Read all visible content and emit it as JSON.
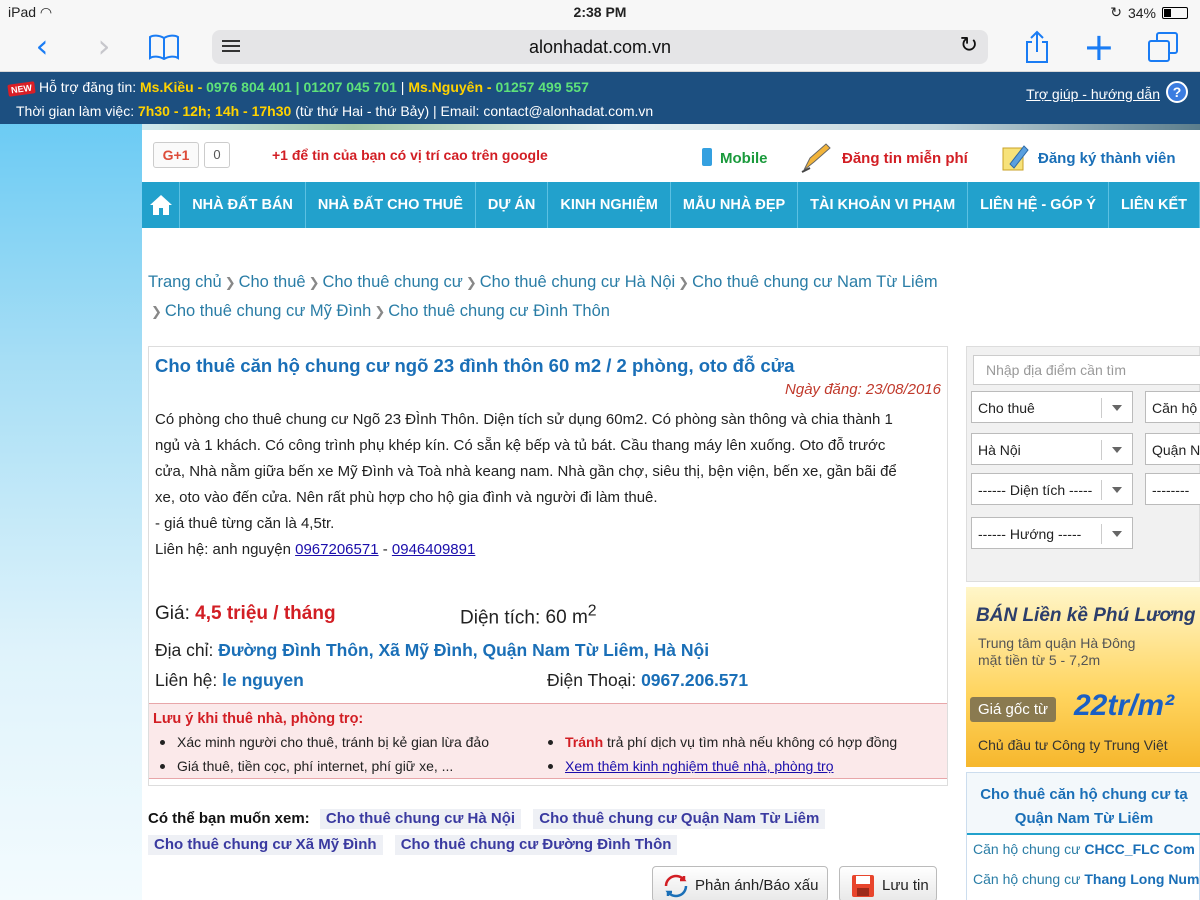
{
  "status": {
    "device": "iPad",
    "time": "2:38 PM",
    "battery": "34%",
    "battery_level": 0.34
  },
  "browser": {
    "url": "alonhadat.com.vn"
  },
  "support": {
    "row1_prefix": "Hỗ trợ đăng tin:",
    "name1": "Ms.Kiều -",
    "phones1": "0976 804 401 | 01207 045 701",
    "name2": "Ms.Nguyên -",
    "phone2": "01257 499 557",
    "row2_prefix": "Thời gian làm việc:",
    "hours": "7h30 - 12h; 14h - 17h30",
    "row2_suffix": "(từ thứ Hai - thứ Bảy) | Email: contact@alonhadat.com.vn",
    "help": "Trợ giúp - hướng dẫn",
    "hot_badge": "NEW"
  },
  "topbar": {
    "gplus": "G+1",
    "gcount": "0",
    "gtext": "+1 để tin của bạn có vị trí cao trên google",
    "mobile": "Mobile",
    "post_free": "Đăng tin miễn phí",
    "register": "Đăng ký thành viên"
  },
  "nav": [
    "NHÀ ĐẤT BÁN",
    "NHÀ ĐẤT CHO THUÊ",
    "DỰ ÁN",
    "KINH NGHIỆM",
    "MẪU NHÀ ĐẸP",
    "TÀI KHOẢN VI PHẠM",
    "LIÊN HỆ - GÓP Ý",
    "LIÊN KẾT"
  ],
  "breadcrumb": [
    "Trang chủ",
    "Cho thuê",
    "Cho thuê chung cư",
    "Cho thuê chung cư Hà Nội",
    "Cho thuê chung cư Nam Từ Liêm",
    "Cho thuê chung cư Mỹ Đình",
    "Cho thuê chung cư Đình Thôn"
  ],
  "listing": {
    "title": "Cho thuê căn hộ chung cư ngõ 23 đình thôn 60 m2 / 2 phòng, oto đỗ cửa",
    "date": "Ngày đăng: 23/08/2016",
    "desc1": "Có phòng cho thuê chung cư Ngõ 23 ĐÌnh Thôn. Diện tích sử dụng 60m2. Có phòng sàn thông và chia thành 1",
    "desc2": "ngủ và 1 khách. Có công trình phụ khép kín. Có sẵn kệ bếp và tủ bát. Cầu thang máy lên xuống. Oto đỗ trước",
    "desc3": "cửa, Nhà nằm giữa bến xe Mỹ Đình và Toà nhà keang nam. Nhà gần chợ, siêu thị, bện viện, bến xe, gần bãi để",
    "desc4": "xe, oto vào đến cửa. Nên rất phù hợp cho hộ gia đình và người đi làm thuê.",
    "desc5": "- giá thuê từng căn là 4,5tr.",
    "contact_prefix": "Liên hệ: anh nguyện",
    "phone_a": "0967206571",
    "phone_sep": "-",
    "phone_b": "0946409891",
    "price_label": "Giá:",
    "price": "4,5 triệu / tháng",
    "area_label": "Diện tích:",
    "area": "60 m",
    "area_sup": "2",
    "addr_label": "Địa chỉ:",
    "addr": "Đường Đình Thôn, Xã Mỹ Đình, Quận Nam Từ Liêm, Hà Nội",
    "contact_label": "Liên hệ:",
    "contact_name": "le nguyen",
    "phone_label": "Điện Thoại:",
    "phone": "0967.206.571"
  },
  "notice": {
    "head": "Lưu ý khi thuê nhà, phòng trọ:",
    "item1": "Xác minh người cho thuê, tránh bị kẻ gian lừa đảo",
    "item2": "Giá thuê, tiền cọc, phí internet, phí giữ xe, ...",
    "item3_bold": "Tránh",
    "item3": "trả phí dịch vụ tìm nhà nếu không có hợp đồng",
    "item4": "Xem thêm kinh nghiệm thuê nhà, phòng trọ"
  },
  "related": {
    "label": "Có thể bạn muốn xem:",
    "tags": [
      "Cho thuê chung cư Hà Nội",
      "Cho thuê chung cư Quận Nam Từ Liêm",
      "Cho thuê chung cư Xã Mỹ Đình",
      "Cho thuê chung cư Đường Đình Thôn"
    ]
  },
  "buttons": {
    "report": "Phản ánh/Báo xấu",
    "save": "Lưu tin"
  },
  "search": {
    "placeholder": "Nhập địa điểm cần tìm",
    "type": "Cho thuê",
    "category": "Căn hộ",
    "city": "Hà Nội",
    "district": "Quận N",
    "area": "------ Diện tích -----",
    "price": "--------",
    "direction": "------ Hướng -----"
  },
  "ad": {
    "h1": "BÁN Liền kề Phú Lương",
    "h2a": "Trung tâm quận Hà Đông",
    "h2b": "mặt tiền từ 5 - 7,2m",
    "goc": "Giá gốc từ",
    "big": "22tr/m²",
    "foot": "Chủ đầu tư Công ty Trung Việt"
  },
  "side_list": {
    "head1": "Cho thuê căn hộ chung cư tạ",
    "head2": "Quận Nam Từ Liêm",
    "row1_a": "Căn hộ chung cư",
    "row1_b": "CHCC_FLC Com",
    "row2_a": "Căn hộ chung cư",
    "row2_b": "Thang Long Num"
  },
  "colors": {
    "nav": "#22a1cc",
    "support": "#1c4f80",
    "link": "#1a6fb7",
    "price": "#d21e24"
  }
}
